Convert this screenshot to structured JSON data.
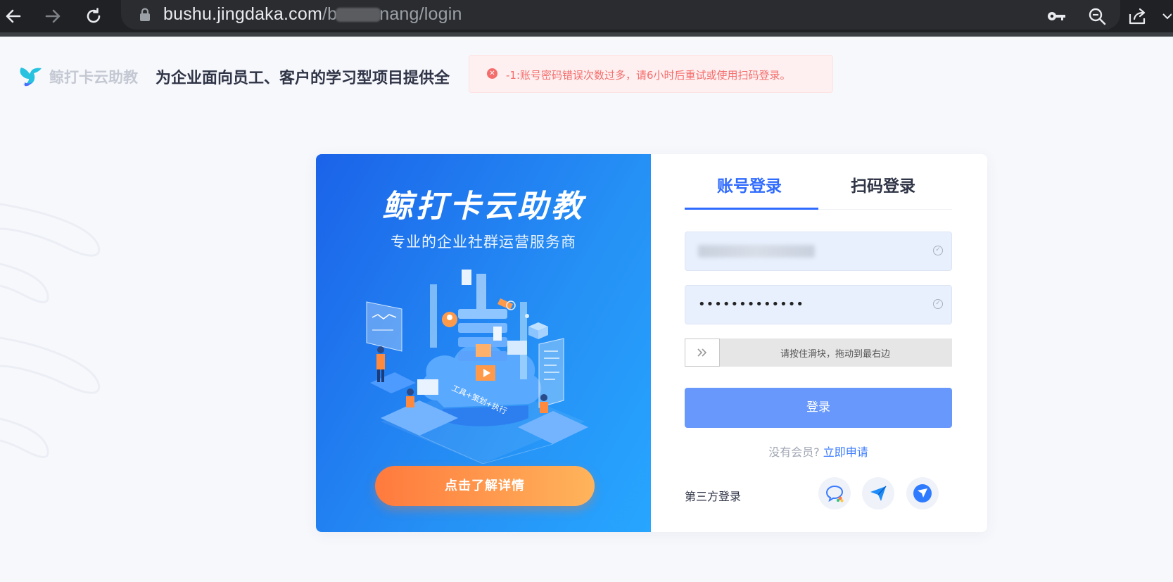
{
  "browser": {
    "url_host": "bushu.jingdaka.com",
    "url_path_prefix": "/b",
    "url_path_suffix": "nang/login"
  },
  "header": {
    "brand": "鲸打卡云助教",
    "slogan": "为企业面向员工、客户的学习型项目提供全"
  },
  "toast": {
    "message": "-1:账号密码错误次数过多，请6小时后重试或使用扫码登录。"
  },
  "promo": {
    "title": "鲸打卡云助教",
    "subtitle": "专业的企业社群运营服务商",
    "illustration_text": "工具+策划+执行",
    "detail_button": "点击了解详情"
  },
  "login": {
    "tab_account": "账号登录",
    "tab_qr": "扫码登录",
    "password_mask": "•••••••••••••",
    "slider_hint": "请按住滑块，拖动到最右边",
    "submit_label": "登录",
    "no_member": "没有会员?",
    "apply_now": "立即申请",
    "third_party_label": "第三方登录"
  },
  "colors": {
    "accent": "#2f6bff",
    "error": "#f56c6c",
    "orange": "#ff8a3d"
  }
}
